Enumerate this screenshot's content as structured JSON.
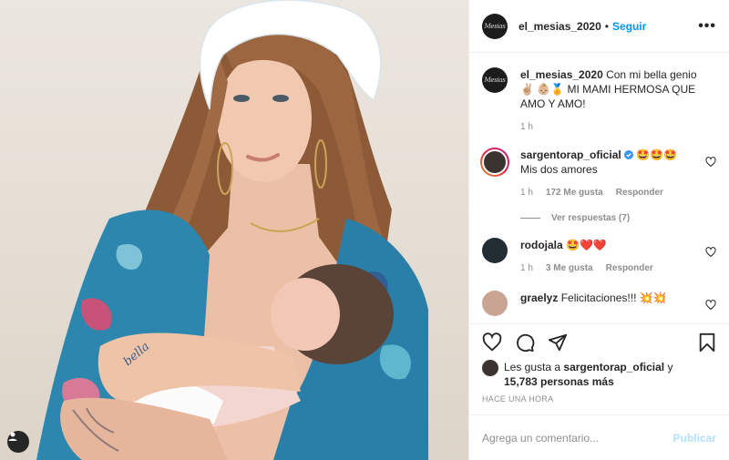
{
  "post": {
    "username": "el_mesias_2020",
    "follow_label": "Seguir",
    "more_label": "•••",
    "avatar_logo": "Mesias",
    "caption_text": "Con mi bella genio ✌🏼 👶🏼🏅 MI MAMI HERMOSA QUE AMO Y AMO!",
    "caption_time": "1 h"
  },
  "comments": [
    {
      "username": "sargentorap_oficial",
      "verified": true,
      "emoji": "🤩🤩🤩",
      "text": "Mis dos amores",
      "time": "1 h",
      "likes": "172 Me gusta",
      "reply_label": "Responder",
      "view_replies": "Ver respuestas (7)"
    },
    {
      "username": "rodojala",
      "emoji": "🤩❤️❤️",
      "text": "",
      "time": "1 h",
      "likes": "3 Me gusta",
      "reply_label": "Responder"
    },
    {
      "username": "graelyz",
      "text": "Felicitaciones!!! 💥💥"
    }
  ],
  "likes": {
    "prefix": "Les gusta a",
    "user": "sargentorap_oficial",
    "joiner": "y",
    "count": "15,783 personas más"
  },
  "timestamp": "HACE UNA HORA",
  "add_comment": {
    "placeholder": "Agrega un comentario...",
    "publish_label": "Publicar"
  },
  "icons": {
    "like": "heart-icon",
    "comment": "comment-icon",
    "share": "paper-plane-icon",
    "save": "bookmark-icon",
    "tag": "user-tag-icon"
  },
  "colors": {
    "link_blue": "#0095f6",
    "publish_disabled": "#b2dffc",
    "muted": "#8e8e8e"
  }
}
